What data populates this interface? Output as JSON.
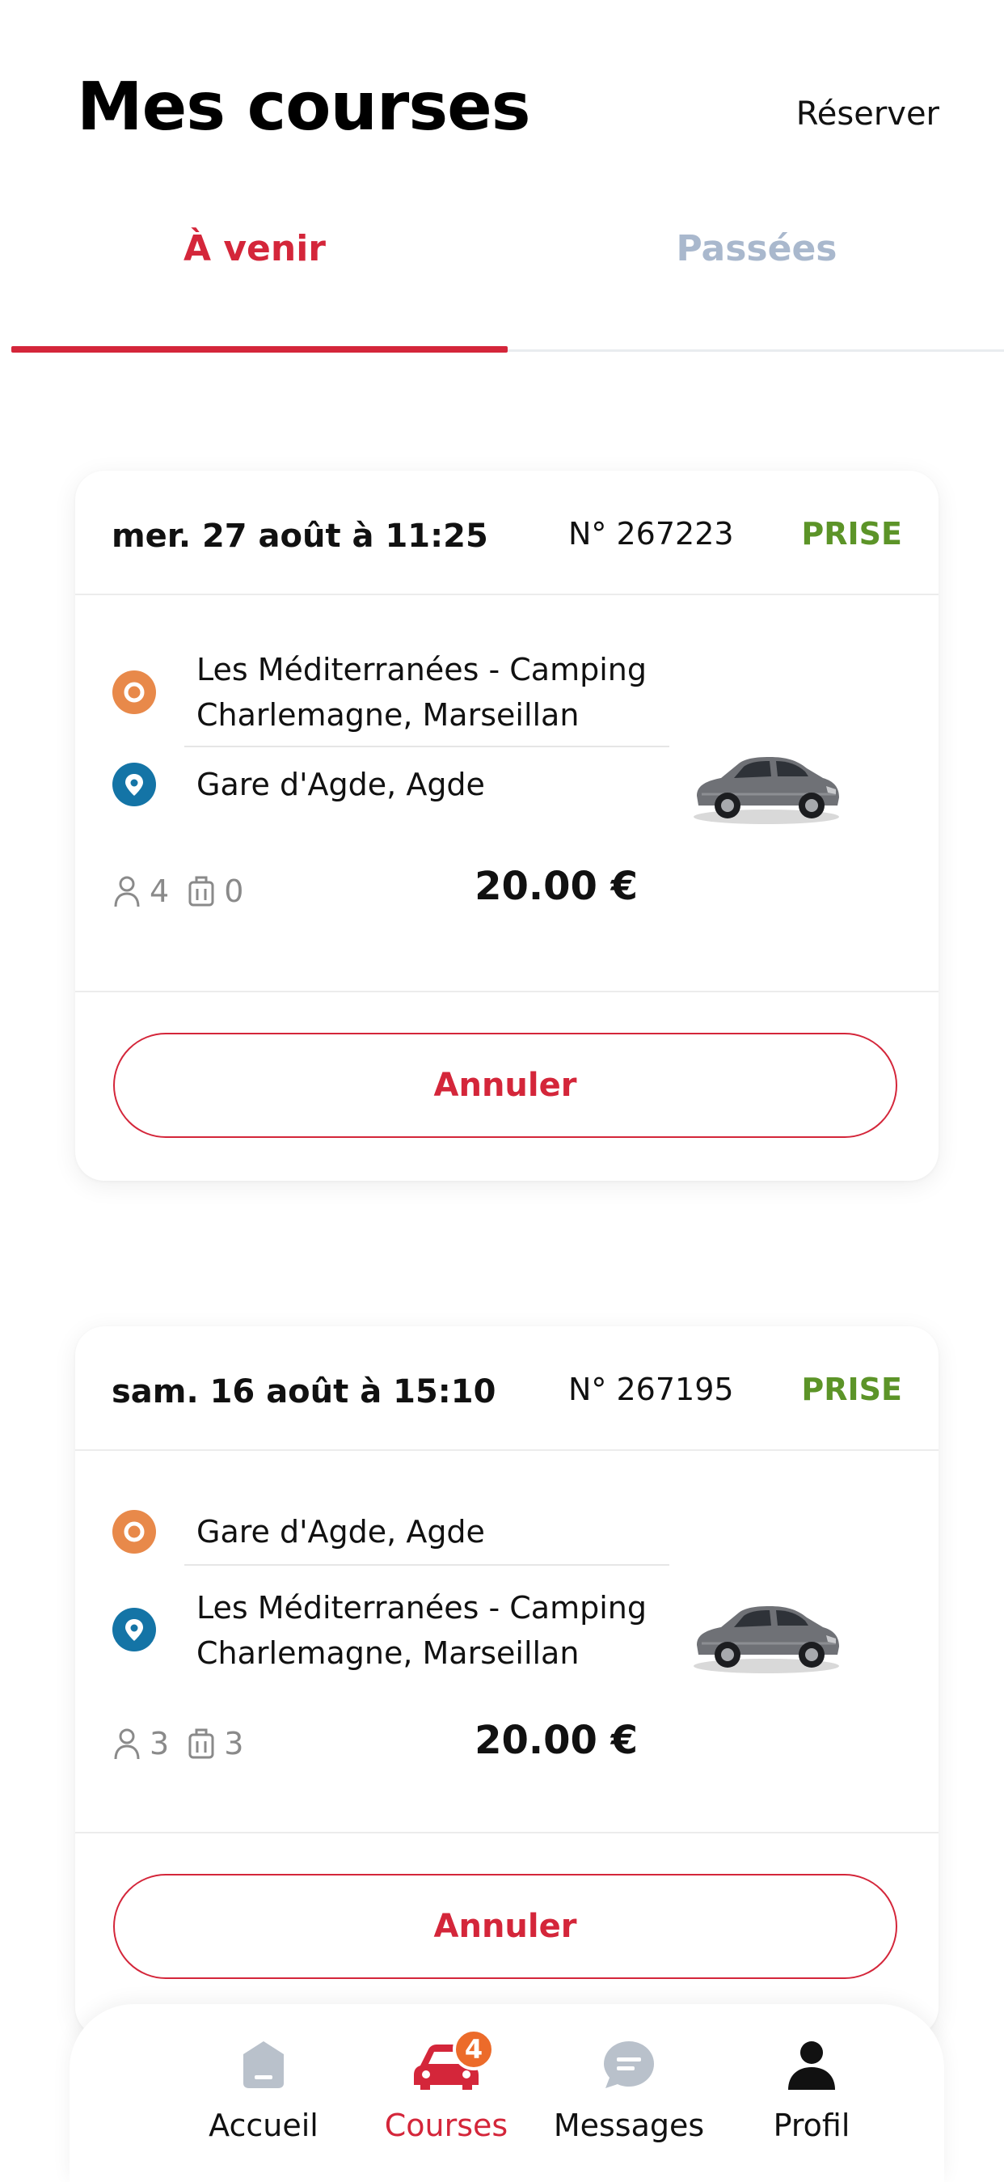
{
  "header": {
    "title": "Mes courses",
    "reserve_label": "Réserver"
  },
  "tabs": [
    {
      "label": "À venir",
      "active": true
    },
    {
      "label": "Passées",
      "active": false
    }
  ],
  "colors": {
    "accent": "#d4263a",
    "status_green": "#5c9428",
    "origin": "#e8894a",
    "destination": "#1474a6",
    "inactive_tab": "#a9b8cd"
  },
  "rides": [
    {
      "date": "mer. 27 août à 11:25",
      "number": "N° 267223",
      "status": "PRISE",
      "origin_lines": [
        "Les Méditerranées - Camping",
        "Charlemagne, Marseillan"
      ],
      "destination_lines": [
        "Gare d'Agde, Agde"
      ],
      "passengers": "4",
      "luggage": "0",
      "price": "20.00 €",
      "cancel_label": "Annuler"
    },
    {
      "date": "sam. 16 août à 15:10",
      "number": "N° 267195",
      "status": "PRISE",
      "origin_lines": [
        "Gare d'Agde, Agde"
      ],
      "destination_lines": [
        "Les Méditerranées - Camping",
        "Charlemagne, Marseillan"
      ],
      "passengers": "3",
      "luggage": "3",
      "price": "20.00 €",
      "cancel_label": "Annuler"
    }
  ],
  "nav": [
    {
      "label": "Accueil",
      "icon": "home-icon"
    },
    {
      "label": "Courses",
      "icon": "car-icon",
      "badge": "4",
      "active": true
    },
    {
      "label": "Messages",
      "icon": "chat-icon"
    },
    {
      "label": "Profil",
      "icon": "user-icon"
    }
  ]
}
